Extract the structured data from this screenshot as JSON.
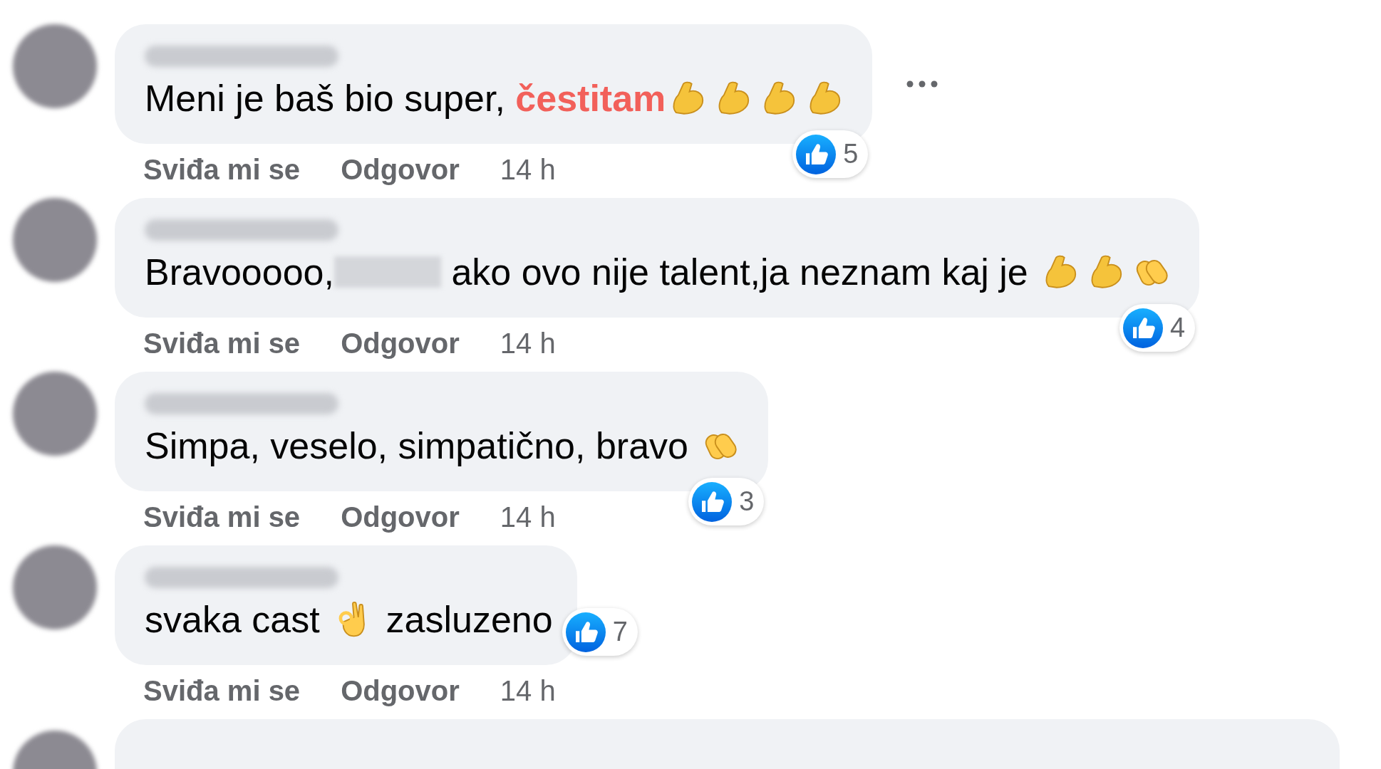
{
  "comments": [
    {
      "options_visible": true,
      "segments": [
        {
          "kind": "text",
          "text": "Meni je baš bio super, "
        },
        {
          "kind": "highlight",
          "text": "čestitam"
        },
        {
          "kind": "muscle"
        },
        {
          "kind": "muscle"
        },
        {
          "kind": "muscle"
        },
        {
          "kind": "muscle"
        }
      ],
      "reactions": "5",
      "actions": {
        "like": "Sviđa mi se",
        "reply": "Odgovor",
        "time": "14 h"
      }
    },
    {
      "options_visible": false,
      "segments": [
        {
          "kind": "text",
          "text": "Bravooooo,"
        },
        {
          "kind": "redacted"
        },
        {
          "kind": "text",
          "text": " ako ovo nije talent,ja neznam kaj je "
        },
        {
          "kind": "muscle"
        },
        {
          "kind": "muscle"
        },
        {
          "kind": "clap"
        }
      ],
      "reactions": "4",
      "actions": {
        "like": "Sviđa mi se",
        "reply": "Odgovor",
        "time": "14 h"
      }
    },
    {
      "options_visible": false,
      "segments": [
        {
          "kind": "text",
          "text": "Simpa, veselo, simpatično, bravo "
        },
        {
          "kind": "clap"
        }
      ],
      "reactions": "3",
      "actions": {
        "like": "Sviđa mi se",
        "reply": "Odgovor",
        "time": "14 h"
      }
    },
    {
      "options_visible": false,
      "segments": [
        {
          "kind": "text",
          "text": "svaka cast "
        },
        {
          "kind": "ok"
        },
        {
          "kind": "text",
          "text": " zasluzeno"
        }
      ],
      "reactions": "7",
      "actions": {
        "like": "Sviđa mi se",
        "reply": "Odgovor",
        "time": "14 h"
      }
    }
  ]
}
